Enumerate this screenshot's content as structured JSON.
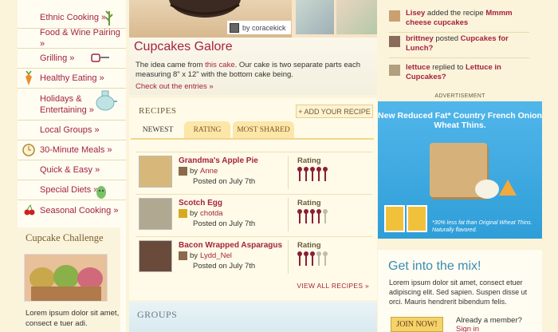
{
  "sidebar": {
    "items": [
      {
        "label": "Ethnic Cooking »",
        "icon": "wheat-icon"
      },
      {
        "label": "Food & Wine Pairing »",
        "icon": ""
      },
      {
        "label": "Grilling »",
        "icon": "grill-tongs-icon"
      },
      {
        "label": "Healthy Eating »",
        "icon": "carrot-icon"
      },
      {
        "label": "Holidays & Entertaining »",
        "icon": "teapot-icon"
      },
      {
        "label": "Local Groups »",
        "icon": ""
      },
      {
        "label": "30-Minute Meals »",
        "icon": "clock-icon"
      },
      {
        "label": "Quick & Easy »",
        "icon": ""
      },
      {
        "label": "Special Diets »",
        "icon": "vegetable-icon"
      },
      {
        "label": "Seasonal Cooking »",
        "icon": "cherries-icon"
      }
    ],
    "cupcake_challenge": {
      "title": "Cupcake Challenge",
      "text": "Lorem ipsum dolor sit amet, consect e tuer adi."
    }
  },
  "hero": {
    "caption": "by coracekick"
  },
  "story": {
    "title": "Cupcakes Galore",
    "text_pre": "The idea came from ",
    "text_link": "this cake",
    "text_post": ". Our cake is two separate parts each measuring 8\" x 12\" with the bottom cake being.",
    "link": "Check out the entries »"
  },
  "recipes": {
    "heading": "RECIPES",
    "add_button": "+ ADD YOUR RECIPE",
    "tabs": [
      "NEWEST",
      "RATING",
      "MOST SHARED"
    ],
    "rows": [
      {
        "title": "Grandma's Apple Pie",
        "by": "by",
        "author": "Anne",
        "posted": "Posted on July 7th",
        "rating_label": "Rating",
        "rating": 5
      },
      {
        "title": "Scotch Egg",
        "by": "by",
        "author": "chotda",
        "posted": "Posted on July 7th",
        "rating_label": "Rating",
        "rating": 4
      },
      {
        "title": "Bacon Wrapped Asparagus",
        "by": "by",
        "author": "Lydd_Nel",
        "posted": "Posted on July 7th",
        "rating_label": "Rating",
        "rating": 3
      }
    ],
    "view_all": "VIEW ALL RECIPES »"
  },
  "groups": {
    "heading": "GROUPS"
  },
  "activity": [
    {
      "user": "Lisey",
      "action": " added the recipe ",
      "target": "Mmmm cheese cupcakes"
    },
    {
      "user": "brittney",
      "action": " posted ",
      "target": "Cupcakes for Lunch?"
    },
    {
      "user": "lettuce",
      "action": " replied to ",
      "target": "Lettuce in Cupcakes?"
    }
  ],
  "ad": {
    "label": "ADVERTISEMENT",
    "headline": "New Reduced Fat* Country French Onion Wheat Thins.",
    "fine_print": "*30% less fat than Original Wheat Thins. Naturally flavored."
  },
  "mix": {
    "title": "Get into the mix!",
    "text": "Lorem ipsum dolor sit amet, consect etuer adipiscing elit. Sed sapien. Suspen disse ut orci. Mauris hendrerit bibendum felis.",
    "join_button": "JOIN NOW!",
    "member_text": "Already a member?",
    "sign_in": "Sign in"
  },
  "colors": {
    "link": "#a4233f",
    "accent_blue": "#3a8bb4",
    "ad_blue": "#2f9ed8",
    "tab_bg": "#fce6a8",
    "page_bg": "#fbf3da"
  }
}
